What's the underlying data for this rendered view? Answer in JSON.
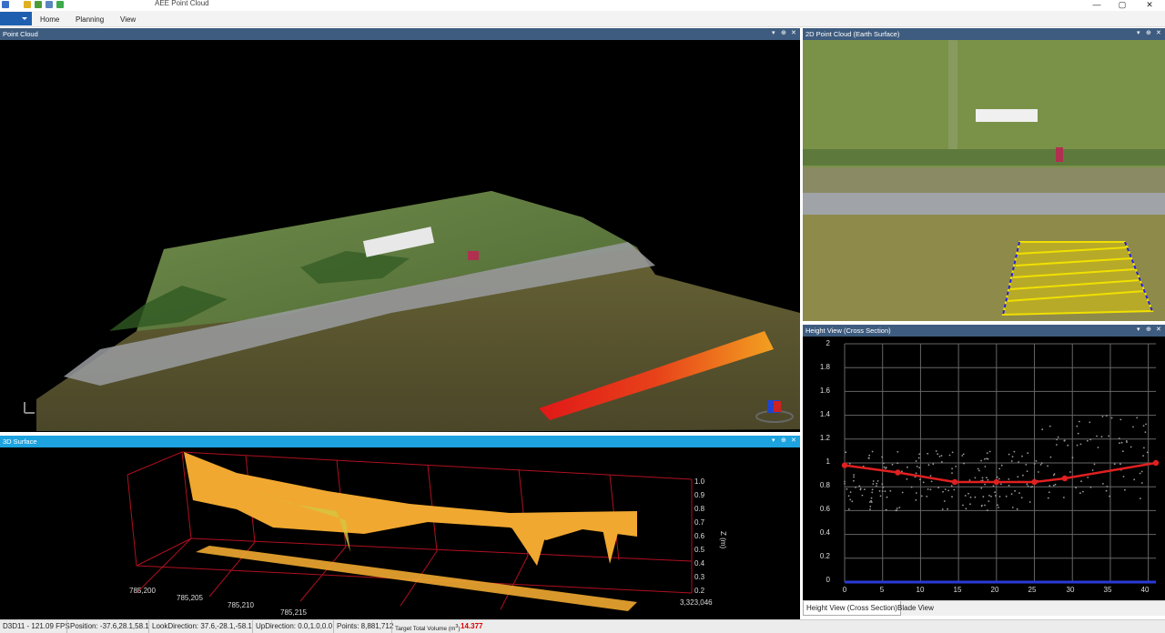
{
  "window": {
    "title": "AEE Point Cloud",
    "controls": {
      "minimize": "—",
      "maximize": "▢",
      "close": "✕"
    }
  },
  "ribbon": {
    "tabs": [
      "Home",
      "Planning",
      "View"
    ]
  },
  "panels": {
    "point_cloud": {
      "title": "Point Cloud"
    },
    "point_cloud_2d": {
      "title": "2D Point Cloud (Earth Surface)"
    },
    "surface_3d": {
      "title": "3D Surface",
      "z_axis_label": "Z (m)",
      "z_ticks": [
        "1.0",
        "0.9",
        "0.8",
        "0.7",
        "0.6",
        "0.5",
        "0.4",
        "0.3",
        "0.2"
      ],
      "x_ticks": [
        "785,200",
        "785,205",
        "785,210",
        "785,215"
      ],
      "y_tick": "3,323,046"
    },
    "height_view": {
      "title": "Height View (Cross Section)",
      "y_ticks": [
        "2",
        "1.8",
        "1.6",
        "1.4",
        "1.2",
        "1",
        "0.8",
        "0.6",
        "0.4",
        "0.2",
        "0"
      ],
      "x_ticks": [
        "0",
        "5",
        "10",
        "15",
        "20",
        "25",
        "30",
        "35",
        "40"
      ]
    }
  },
  "bottom_tabs": [
    "Height View (Cross Section)",
    "Blade View"
  ],
  "status": {
    "renderer": "D3D11 - 121.09 FPS",
    "position": "Position: -37.6,28.1,58.1",
    "look_direction": "LookDirection: 37.6,-28.1,-58.1",
    "up_direction": "UpDirection: 0.0,1.0,0.0",
    "points": "Points: 8,881,712",
    "target_volume_label": "Target Total Volume (m",
    "target_volume_unit_sup": "3",
    "target_volume_value": "14.377"
  },
  "colors": {
    "accent": "#1ca3e0",
    "file_tab": "#1f5fb0",
    "panel_header": "#3e5c7f",
    "profile_line": "#e02020",
    "volume_value": "#dd0000"
  },
  "chart_data": {
    "type": "scatter",
    "title": "Height View (Cross Section)",
    "xlabel": "",
    "ylabel": "",
    "xlim": [
      0,
      41
    ],
    "ylim": [
      0,
      2
    ],
    "grid": true,
    "series": [
      {
        "type": "line",
        "x": [
          0,
          7,
          14.5,
          20,
          25,
          29,
          41
        ],
        "values": [
          0.98,
          0.92,
          0.84,
          0.84,
          0.84,
          0.87,
          1.0
        ]
      }
    ]
  }
}
